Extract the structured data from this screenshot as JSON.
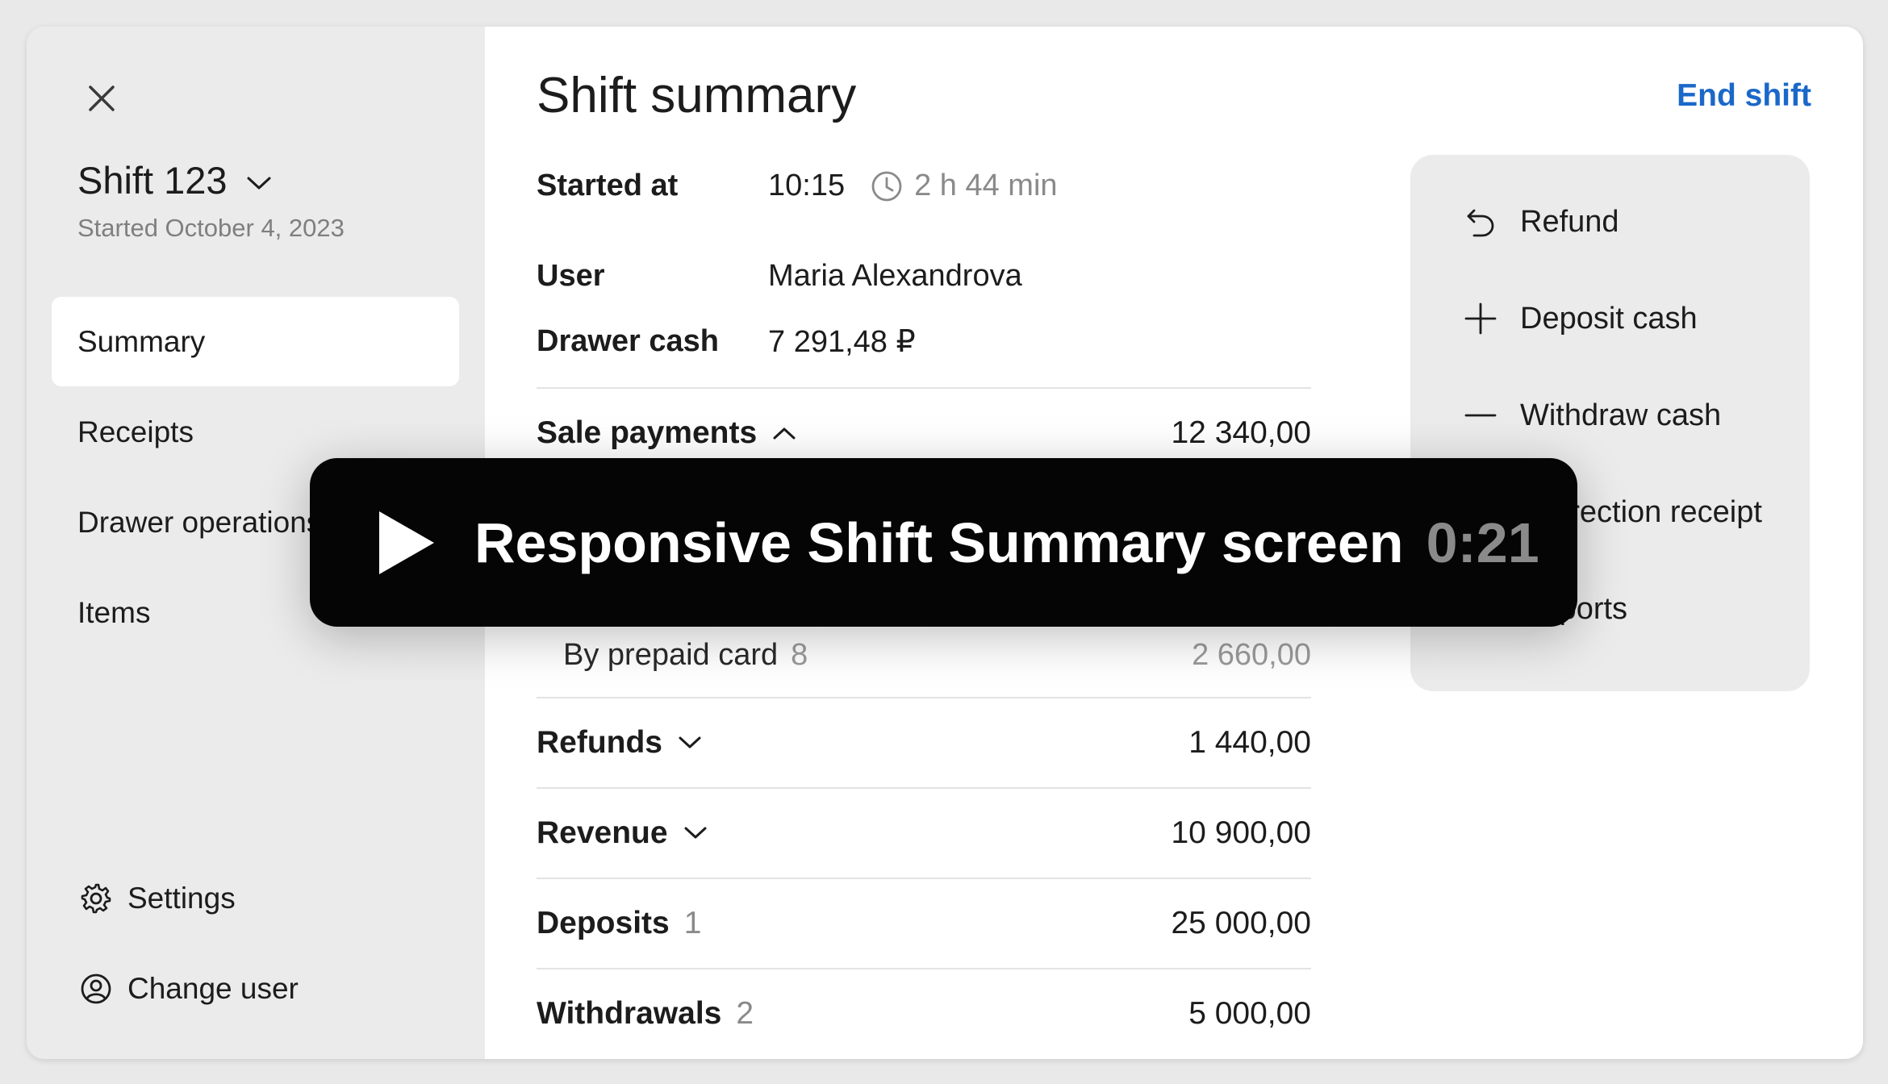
{
  "sidebar": {
    "shift_title": "Shift 123",
    "shift_subtitle": "Started October 4, 2023",
    "items": [
      {
        "label": "Summary",
        "active": true
      },
      {
        "label": "Receipts"
      },
      {
        "label": "Drawer operations"
      },
      {
        "label": "Items"
      }
    ],
    "settings_label": "Settings",
    "change_user_label": "Change user"
  },
  "main": {
    "title": "Shift summary",
    "end_shift_label": "End shift",
    "info": {
      "started_label": "Started at",
      "started_value": "10:15",
      "duration": "2 h 44 min",
      "user_label": "User",
      "user_value": "Maria Alexandrova",
      "cash_label": "Drawer cash",
      "cash_value": "7 291,48 ₽"
    },
    "sale_payments": {
      "label": "Sale payments",
      "amount": "12 340,00"
    },
    "prepaid": {
      "label": "By prepaid card",
      "count": "8",
      "amount": "2 660,00"
    },
    "rows": [
      {
        "label": "Refunds",
        "count": "",
        "amount": "1 440,00"
      },
      {
        "label": "Revenue",
        "count": "",
        "amount": "10 900,00"
      },
      {
        "label": "Deposits",
        "count": "1",
        "amount": "25 000,00"
      },
      {
        "label": "Withdrawals",
        "count": "2",
        "amount": "5 000,00"
      }
    ]
  },
  "actions": {
    "refund": "Refund",
    "deposit": "Deposit cash",
    "withdraw": "Withdraw cash",
    "correction": "Correction receipt",
    "reports": "Reports"
  },
  "video": {
    "title": "Responsive Shift Summary screen",
    "time": "0:21"
  },
  "colors": {
    "accent": "#1a68c9",
    "sidebar_bg": "#ebebeb",
    "banner_bg": "#050505"
  }
}
